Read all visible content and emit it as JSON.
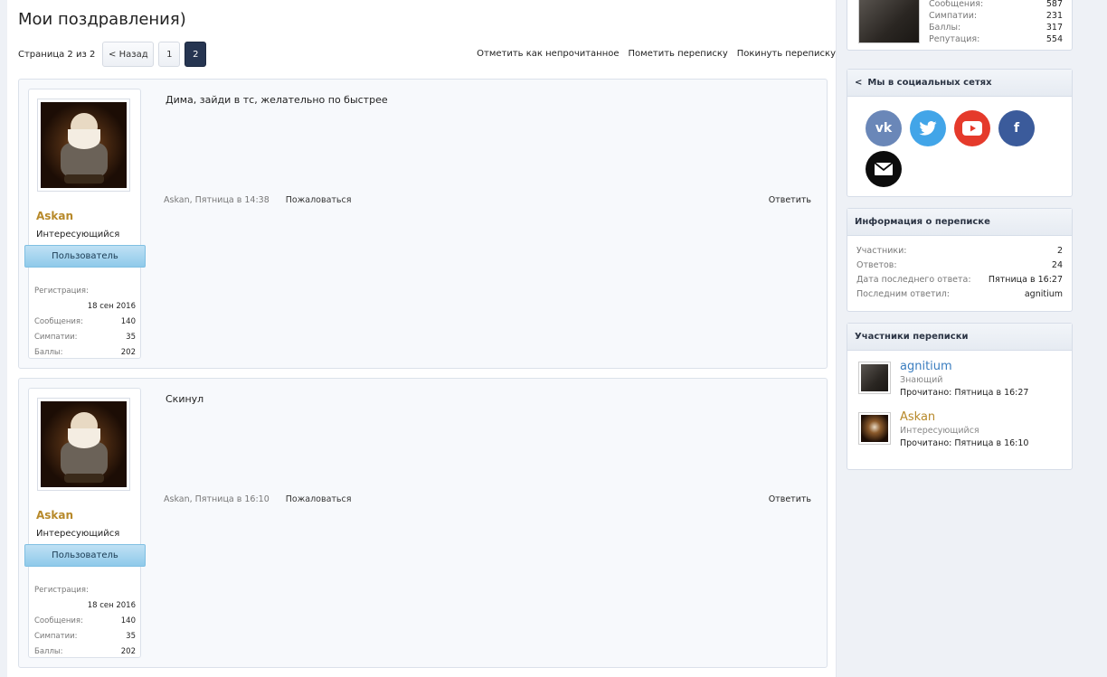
{
  "page": {
    "title": "Мои поздравления)",
    "page_label": "Страница 2 из 2",
    "back_label": "< Назад",
    "pages": [
      "1",
      "2"
    ],
    "conv_links": [
      "Отметить как непрочитанное",
      "Пометить переписку",
      "Покинуть переписку"
    ]
  },
  "messages": [
    {
      "user": {
        "name": "Askan",
        "title": "Интересующийся",
        "role": "Пользователь",
        "stats": {
          "reg_label": "Регистрация:",
          "reg_value": "18 сен 2016",
          "msgs_label": "Сообщения:",
          "msgs_value": "140",
          "likes_label": "Симпатии:",
          "likes_value": "35",
          "points_label": "Баллы:",
          "points_value": "202"
        }
      },
      "text": "Дима, зайди в тс, желательно по быстрее",
      "meta": "Askan, Пятница в 14:38",
      "report": "Пожаловаться",
      "reply": "Ответить"
    },
    {
      "user": {
        "name": "Askan",
        "title": "Интересующийся",
        "role": "Пользователь",
        "stats": {
          "reg_label": "Регистрация:",
          "reg_value": "18 сен 2016",
          "msgs_label": "Сообщения:",
          "msgs_value": "140",
          "likes_label": "Симпатии:",
          "likes_value": "35",
          "points_label": "Баллы:",
          "points_value": "202"
        }
      },
      "text": "Скинул",
      "meta": "Askan, Пятница в 16:10",
      "report": "Пожаловаться",
      "reply": "Ответить"
    }
  ],
  "sidebar": {
    "top_stats": [
      {
        "label": "Сообщения:",
        "value": "587"
      },
      {
        "label": "Симпатии:",
        "value": "231"
      },
      {
        "label": "Баллы:",
        "value": "317"
      },
      {
        "label": "Репутация:",
        "value": "554"
      }
    ],
    "social": {
      "title": "Мы в социальных сетях",
      "icons": [
        "vk-icon",
        "twitter-icon",
        "youtube-icon",
        "facebook-icon",
        "mail-icon"
      ]
    },
    "info": {
      "title": "Информация о переписке",
      "rows": [
        {
          "label": "Участники:",
          "value": "2"
        },
        {
          "label": "Ответов:",
          "value": "24"
        },
        {
          "label": "Дата последнего ответа:",
          "value": "Пятница в 16:27"
        },
        {
          "label": "Последним ответил:",
          "value": "agnitium"
        }
      ]
    },
    "participants": {
      "title": "Участники переписки",
      "items": [
        {
          "name": "agnitium",
          "role": "Знающий",
          "read": "Прочитано: Пятница в 16:27"
        },
        {
          "name": "Askan",
          "role": "Интересующийся",
          "read": "Прочитано: Пятница в 16:10"
        }
      ]
    }
  },
  "colors": {
    "accent_dark": "#263551",
    "gold_name": "#b7892a",
    "blue_name": "#3a7dbf",
    "role_badge": "#8fcaea"
  }
}
